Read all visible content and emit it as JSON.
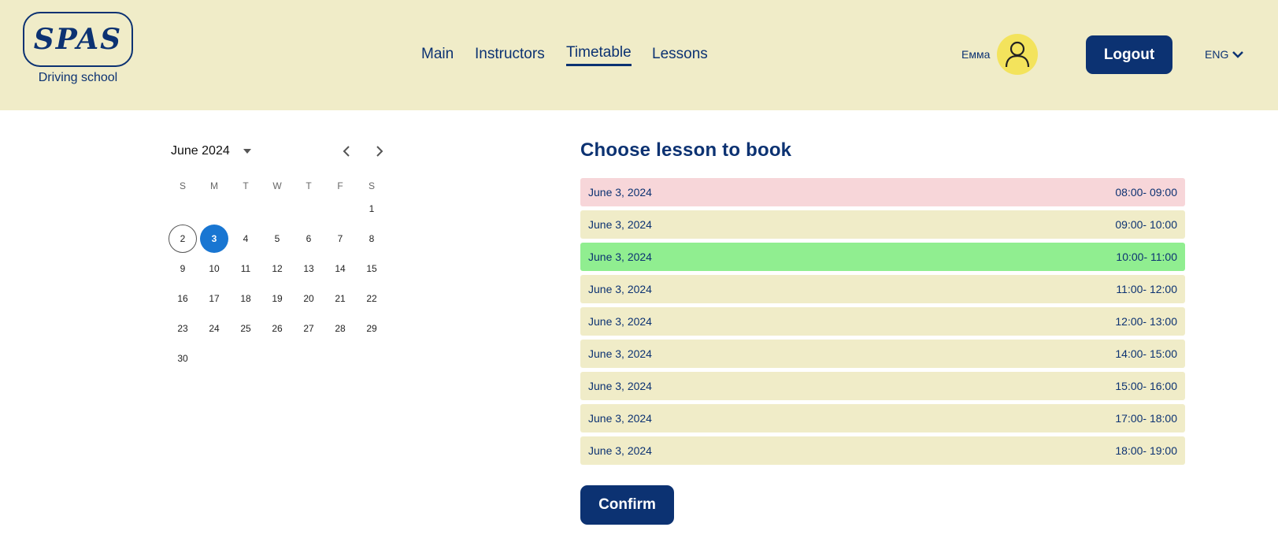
{
  "brand": {
    "logo": "SPAS",
    "subtitle": "Driving school"
  },
  "nav": [
    {
      "label": "Main",
      "active": false
    },
    {
      "label": "Instructors",
      "active": false
    },
    {
      "label": "Timetable",
      "active": true
    },
    {
      "label": "Lessons",
      "active": false
    }
  ],
  "user": {
    "name": "Емма",
    "icon": "user-icon"
  },
  "logout_label": "Logout",
  "language": "ENG",
  "calendar": {
    "month_label": "June 2024",
    "weekdays": [
      "S",
      "M",
      "T",
      "W",
      "T",
      "F",
      "S"
    ],
    "weeks": [
      [
        "",
        "",
        "",
        "",
        "",
        "",
        "1"
      ],
      [
        "2",
        "3",
        "4",
        "5",
        "6",
        "7",
        "8"
      ],
      [
        "9",
        "10",
        "11",
        "12",
        "13",
        "14",
        "15"
      ],
      [
        "16",
        "17",
        "18",
        "19",
        "20",
        "21",
        "22"
      ],
      [
        "23",
        "24",
        "25",
        "26",
        "27",
        "28",
        "29"
      ],
      [
        "30",
        "",
        "",
        "",
        "",
        "",
        ""
      ]
    ],
    "today": "2",
    "selected": "3"
  },
  "booking": {
    "title": "Choose lesson to book",
    "slots": [
      {
        "date": "June 3, 2024",
        "time": "08:00- 09:00",
        "color": "#f7d6d9"
      },
      {
        "date": "June 3, 2024",
        "time": "09:00- 10:00",
        "color": "#f0ecc8"
      },
      {
        "date": "June 3, 2024",
        "time": "10:00- 11:00",
        "color": "#90ee90"
      },
      {
        "date": "June 3, 2024",
        "time": "11:00- 12:00",
        "color": "#f0ecc8"
      },
      {
        "date": "June 3, 2024",
        "time": "12:00- 13:00",
        "color": "#f0ecc8"
      },
      {
        "date": "June 3, 2024",
        "time": "14:00- 15:00",
        "color": "#f0ecc8"
      },
      {
        "date": "June 3, 2024",
        "time": "15:00- 16:00",
        "color": "#f0ecc8"
      },
      {
        "date": "June 3, 2024",
        "time": "17:00- 18:00",
        "color": "#f0ecc8"
      },
      {
        "date": "June 3, 2024",
        "time": "18:00- 19:00",
        "color": "#f0ecc8"
      }
    ],
    "confirm_label": "Confirm"
  },
  "colors": {
    "primary": "#0c3272",
    "header_bg": "#f0ecc8",
    "selected_day": "#1976d2",
    "avatar_bg": "#f3e35c"
  }
}
